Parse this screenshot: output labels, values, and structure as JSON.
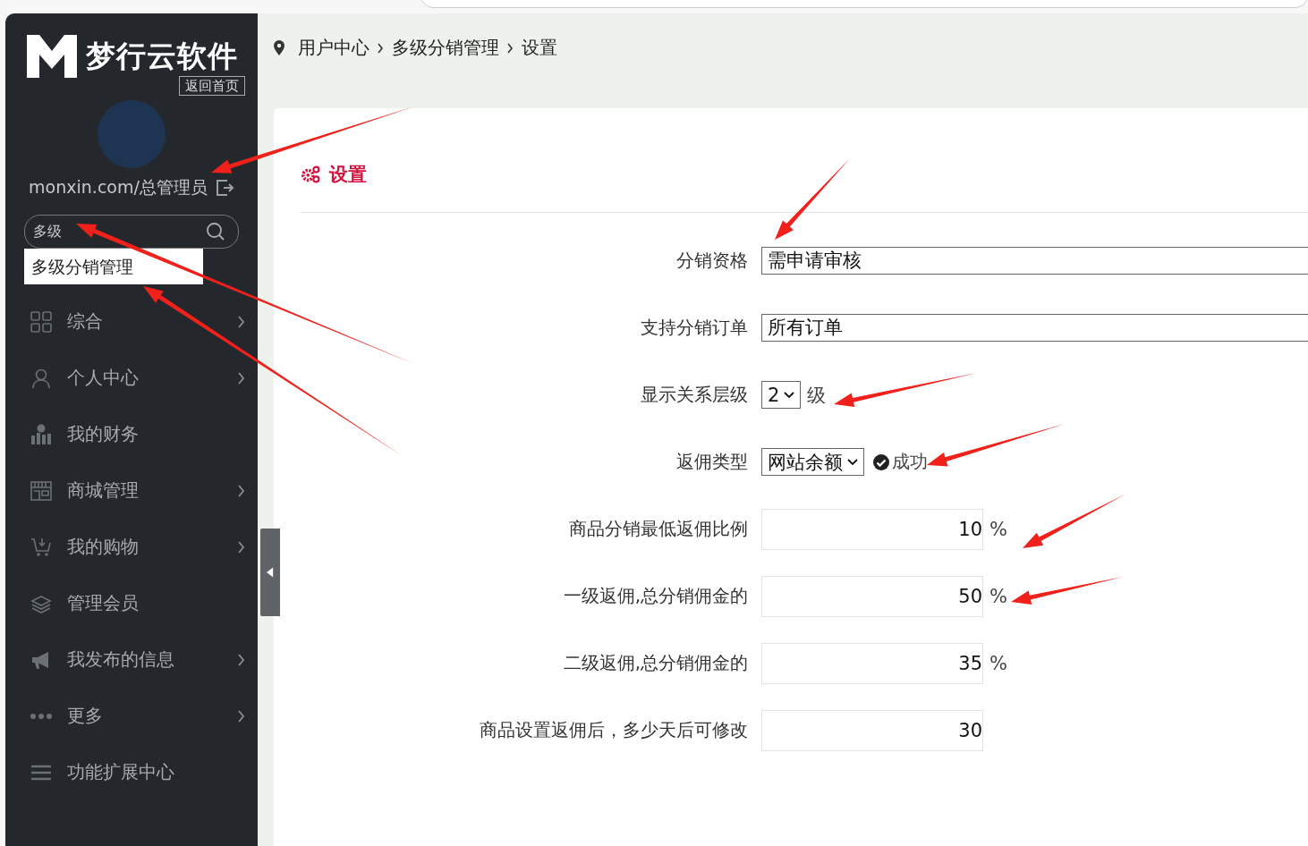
{
  "logo": {
    "brand": "梦行云软件",
    "home_link": "返回首页"
  },
  "user": {
    "name": "monxin.com/总管理员"
  },
  "search": {
    "value": "多级"
  },
  "search_results": [
    "多级分销管理"
  ],
  "nav": [
    {
      "label": "综合",
      "has_submenu": true
    },
    {
      "label": "个人中心",
      "has_submenu": true
    },
    {
      "label": "我的财务",
      "has_submenu": false
    },
    {
      "label": "商城管理",
      "has_submenu": true
    },
    {
      "label": "我的购物",
      "has_submenu": true
    },
    {
      "label": "管理会员",
      "has_submenu": false
    },
    {
      "label": "我发布的信息",
      "has_submenu": true
    },
    {
      "label": "更多",
      "has_submenu": true
    },
    {
      "label": "功能扩展中心",
      "has_submenu": false
    }
  ],
  "breadcrumb": [
    "用户中心",
    "多级分销管理",
    "设置"
  ],
  "panel": {
    "title": "设置"
  },
  "fields": [
    {
      "kind": "text",
      "label": "分销资格",
      "value": "需申请审核"
    },
    {
      "kind": "text",
      "label": "支持分销订单",
      "value": "所有订单"
    },
    {
      "kind": "select",
      "label": "显示关系层级",
      "value": "2",
      "suffix": "级"
    },
    {
      "kind": "select",
      "label": "返佣类型",
      "value": "网站余额",
      "status": "成功"
    },
    {
      "kind": "number",
      "label": "商品分销最低返佣比例",
      "value": "10",
      "suffix": "%"
    },
    {
      "kind": "number",
      "label": "一级返佣,总分销佣金的",
      "value": "50",
      "suffix": "%"
    },
    {
      "kind": "number",
      "label": "二级返佣,总分销佣金的",
      "value": "35",
      "suffix": "%"
    },
    {
      "kind": "number",
      "label": "商品设置返佣后，多少天后可修改",
      "value": "30"
    }
  ]
}
